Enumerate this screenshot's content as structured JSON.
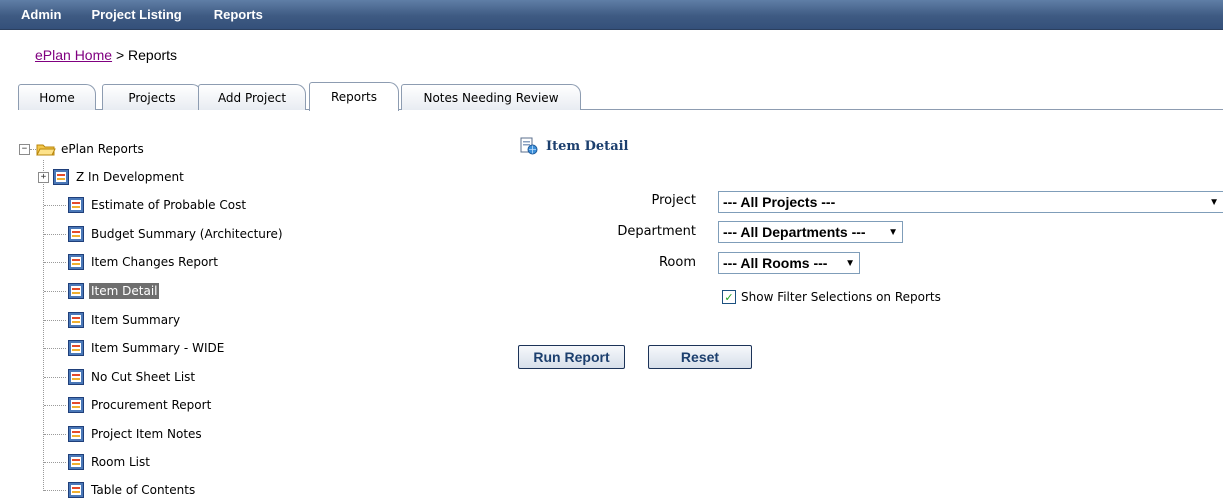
{
  "topnav": {
    "items": [
      "Admin",
      "Project Listing",
      "Reports"
    ]
  },
  "breadcrumb": {
    "home_link": "ePlan Home",
    "separator": ">",
    "current": "Reports"
  },
  "tabs": [
    {
      "label": "Home"
    },
    {
      "label": "Projects"
    },
    {
      "label": "Add Project"
    },
    {
      "label": "Reports",
      "active": true
    },
    {
      "label": "Notes Needing Review"
    }
  ],
  "tree": {
    "root_label": "ePlan Reports",
    "root_expander": "−",
    "items": [
      {
        "label": "Z In Development",
        "expander": "+"
      },
      {
        "label": "Estimate of Probable Cost"
      },
      {
        "label": "Budget Summary (Architecture)"
      },
      {
        "label": "Item Changes Report"
      },
      {
        "label": "Item Detail",
        "selected": true
      },
      {
        "label": "Item Summary"
      },
      {
        "label": "Item Summary - WIDE"
      },
      {
        "label": "No Cut Sheet List"
      },
      {
        "label": "Procurement Report"
      },
      {
        "label": "Project Item Notes"
      },
      {
        "label": "Room List"
      },
      {
        "label": "Table of Contents"
      }
    ]
  },
  "panel": {
    "title": "Item Detail",
    "fields": {
      "project": {
        "label": "Project",
        "value": "--- All Projects ---"
      },
      "department": {
        "label": "Department",
        "value": "--- All Departments ---"
      },
      "room": {
        "label": "Room",
        "value": "--- All Rooms ---"
      }
    },
    "show_filters": {
      "label": "Show Filter Selections on Reports",
      "checked": true
    },
    "buttons": {
      "run": "Run Report",
      "reset": "Reset"
    }
  },
  "colors": {
    "nav_bg": "#3e5a82",
    "link_visited": "#800080",
    "title_blue": "#1c3f6e",
    "selected_bg": "#6e6e6e"
  }
}
